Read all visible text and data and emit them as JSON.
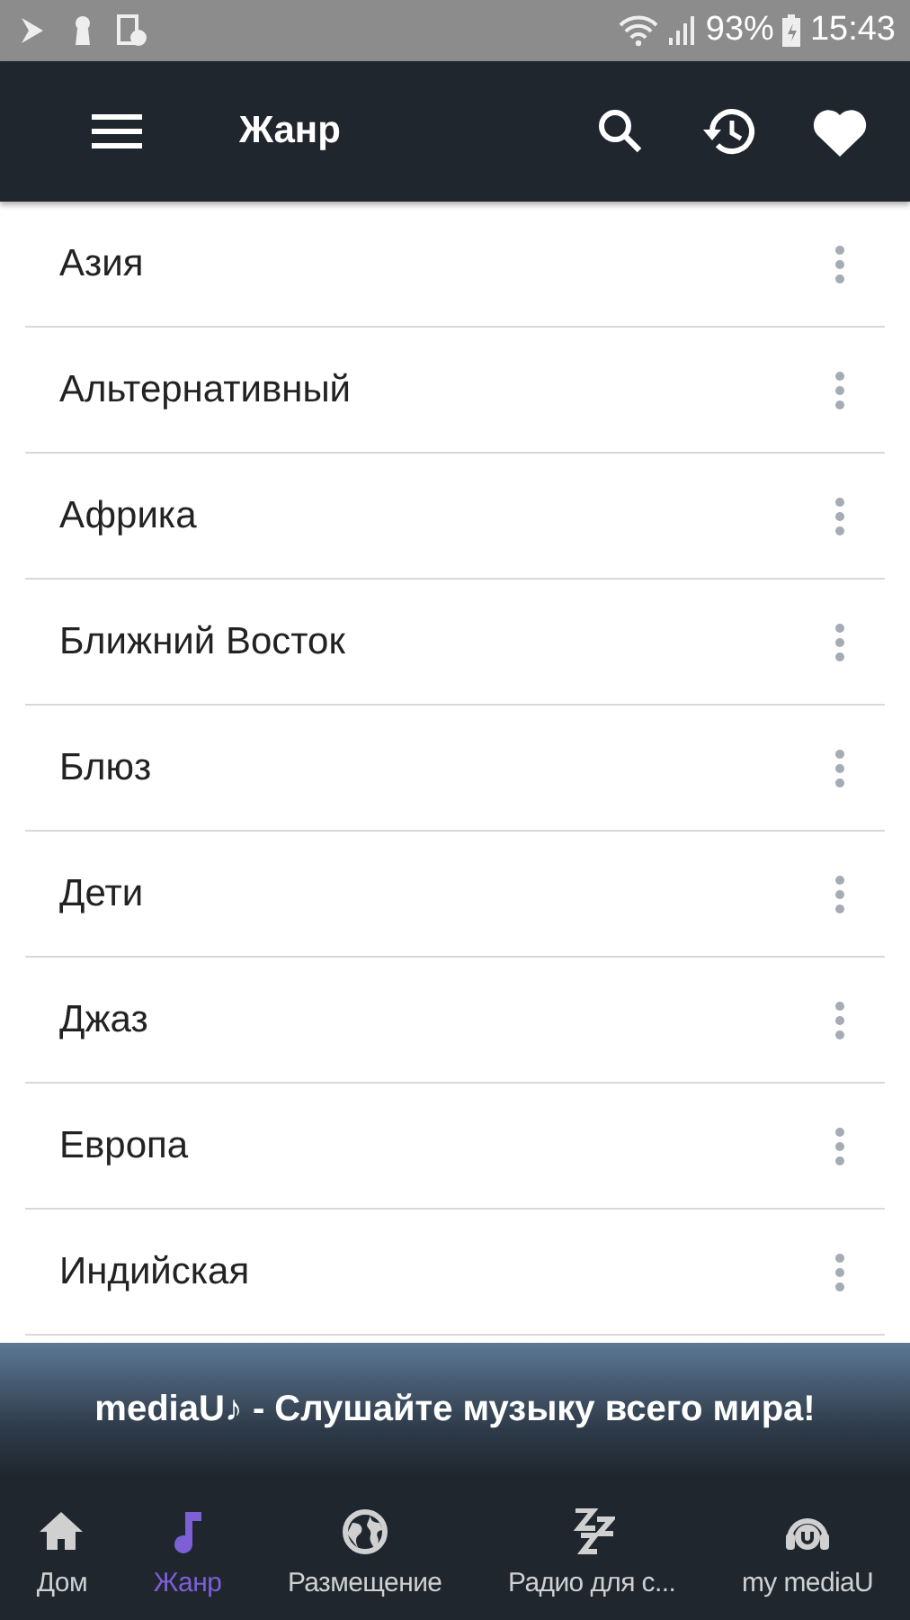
{
  "status_bar": {
    "battery": "93%",
    "time": "15:43"
  },
  "app_bar": {
    "title": "Жанр"
  },
  "genres": [
    {
      "label": "Азия"
    },
    {
      "label": "Альтернативный"
    },
    {
      "label": "Африка"
    },
    {
      "label": "Ближний Восток"
    },
    {
      "label": "Блюз"
    },
    {
      "label": "Дети"
    },
    {
      "label": "Джаз"
    },
    {
      "label": "Европа"
    },
    {
      "label": "Индийская"
    }
  ],
  "banner": "mediaU♪ - Слушайте музыку всего мира!",
  "bottom_nav": [
    {
      "kind": "home",
      "label": "Дом",
      "selected": false
    },
    {
      "kind": "note",
      "label": "Жанр",
      "selected": true
    },
    {
      "kind": "globe",
      "label": "Размещение",
      "selected": false
    },
    {
      "kind": "sleep",
      "label": "Радио для с...",
      "selected": false
    },
    {
      "kind": "headphones",
      "label": "my mediaU",
      "selected": false
    }
  ]
}
